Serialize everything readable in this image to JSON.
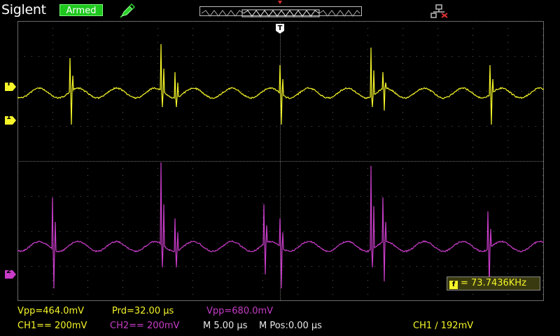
{
  "header": {
    "brand": "Siglent",
    "status": "Armed",
    "probe_icon": "probe-pen-icon",
    "usb_icon": "usb-disconnected-icon"
  },
  "markers": {
    "trigger_top": "T",
    "trigger_ch1": "T",
    "ch1": "1",
    "ch2": "2"
  },
  "colors": {
    "ch1": "#f5f52a",
    "ch2": "#c83cc8",
    "status_bg": "#1ec81e",
    "grid": "#5a5a5a"
  },
  "measurements": {
    "freq": "= 73.7436KHz",
    "ch1_vpp": "Vpp=464.0mV",
    "prd": "Prd=32.00 µs",
    "ch2_vpp": "Vpp=680.0mV"
  },
  "settings": {
    "ch1_scale": "CH1== 200mV",
    "ch2_scale": "CH2== 200mV",
    "timebase": "M 5.00 µs",
    "mpos": "M Pos:0.00 µs",
    "trigger": "CH1 ∕ 192mV"
  }
}
